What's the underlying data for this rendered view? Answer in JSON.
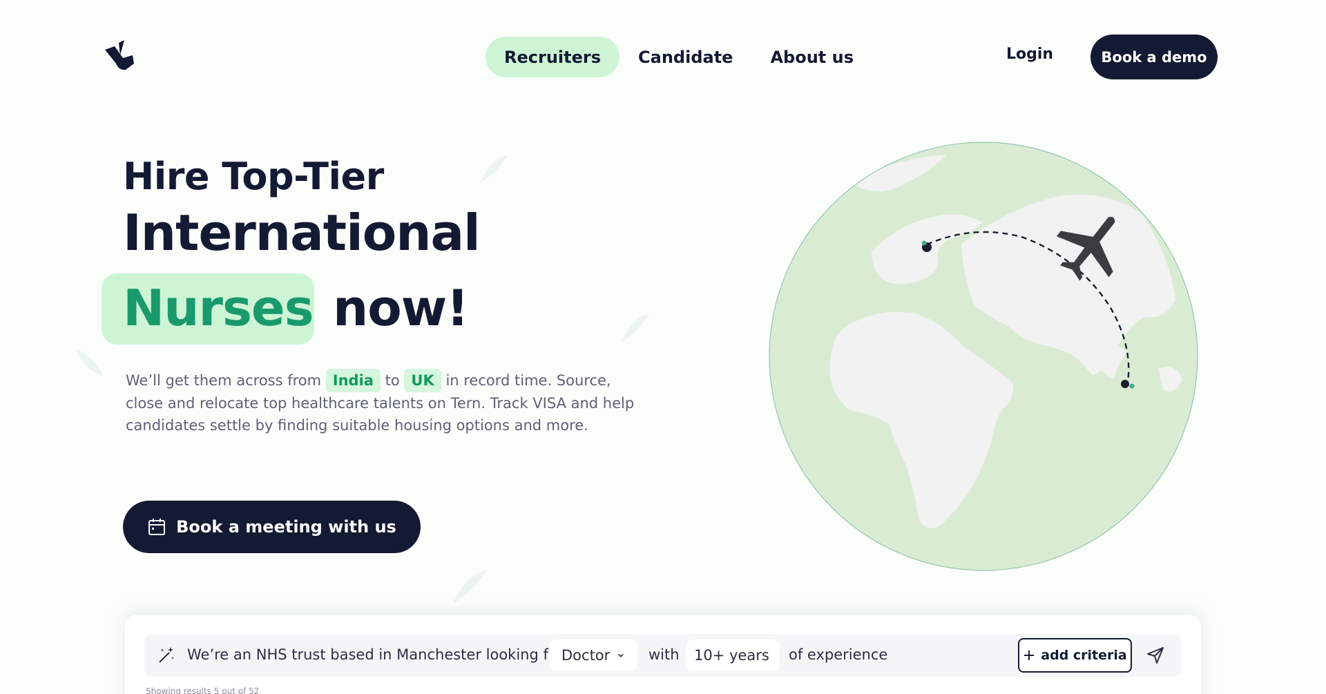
{
  "nav": {
    "links": [
      {
        "label": "Recruiters",
        "active": true
      },
      {
        "label": "Candidate",
        "active": false
      },
      {
        "label": "About us",
        "active": false
      }
    ],
    "login": "Login",
    "demo": "Book a demo"
  },
  "hero": {
    "line1": "Hire Top-Tier",
    "line2": "International",
    "highlight": "Nurses",
    "line3_end": "now!",
    "desc_part1": "We’ll get them across from",
    "chip_from": "India",
    "desc_to": "to",
    "chip_to": "UK",
    "desc_part2": "in record time. Source, close and relocate top healthcare talents on Tern. Track VISA and help candidates settle by finding suitable housing options and more.",
    "cta": "Book a meeting with us"
  },
  "search": {
    "prefix": "We’re an NHS trust based in Manchester looking for a",
    "role": "Doctor",
    "with": "with",
    "experience": "10+ years",
    "suffix": "of experience",
    "add": "add criteria",
    "results": "Showing results 5 out of 52"
  },
  "colors": {
    "navy": "#141a33",
    "mint": "#cdf5d5",
    "green": "#1a9a6c"
  },
  "icons": [
    "tern-logo-icon",
    "calendar-icon",
    "magic-wand-icon",
    "chevron-down-icon",
    "plus-icon",
    "send-icon",
    "airplane-icon",
    "globe-icon"
  ]
}
